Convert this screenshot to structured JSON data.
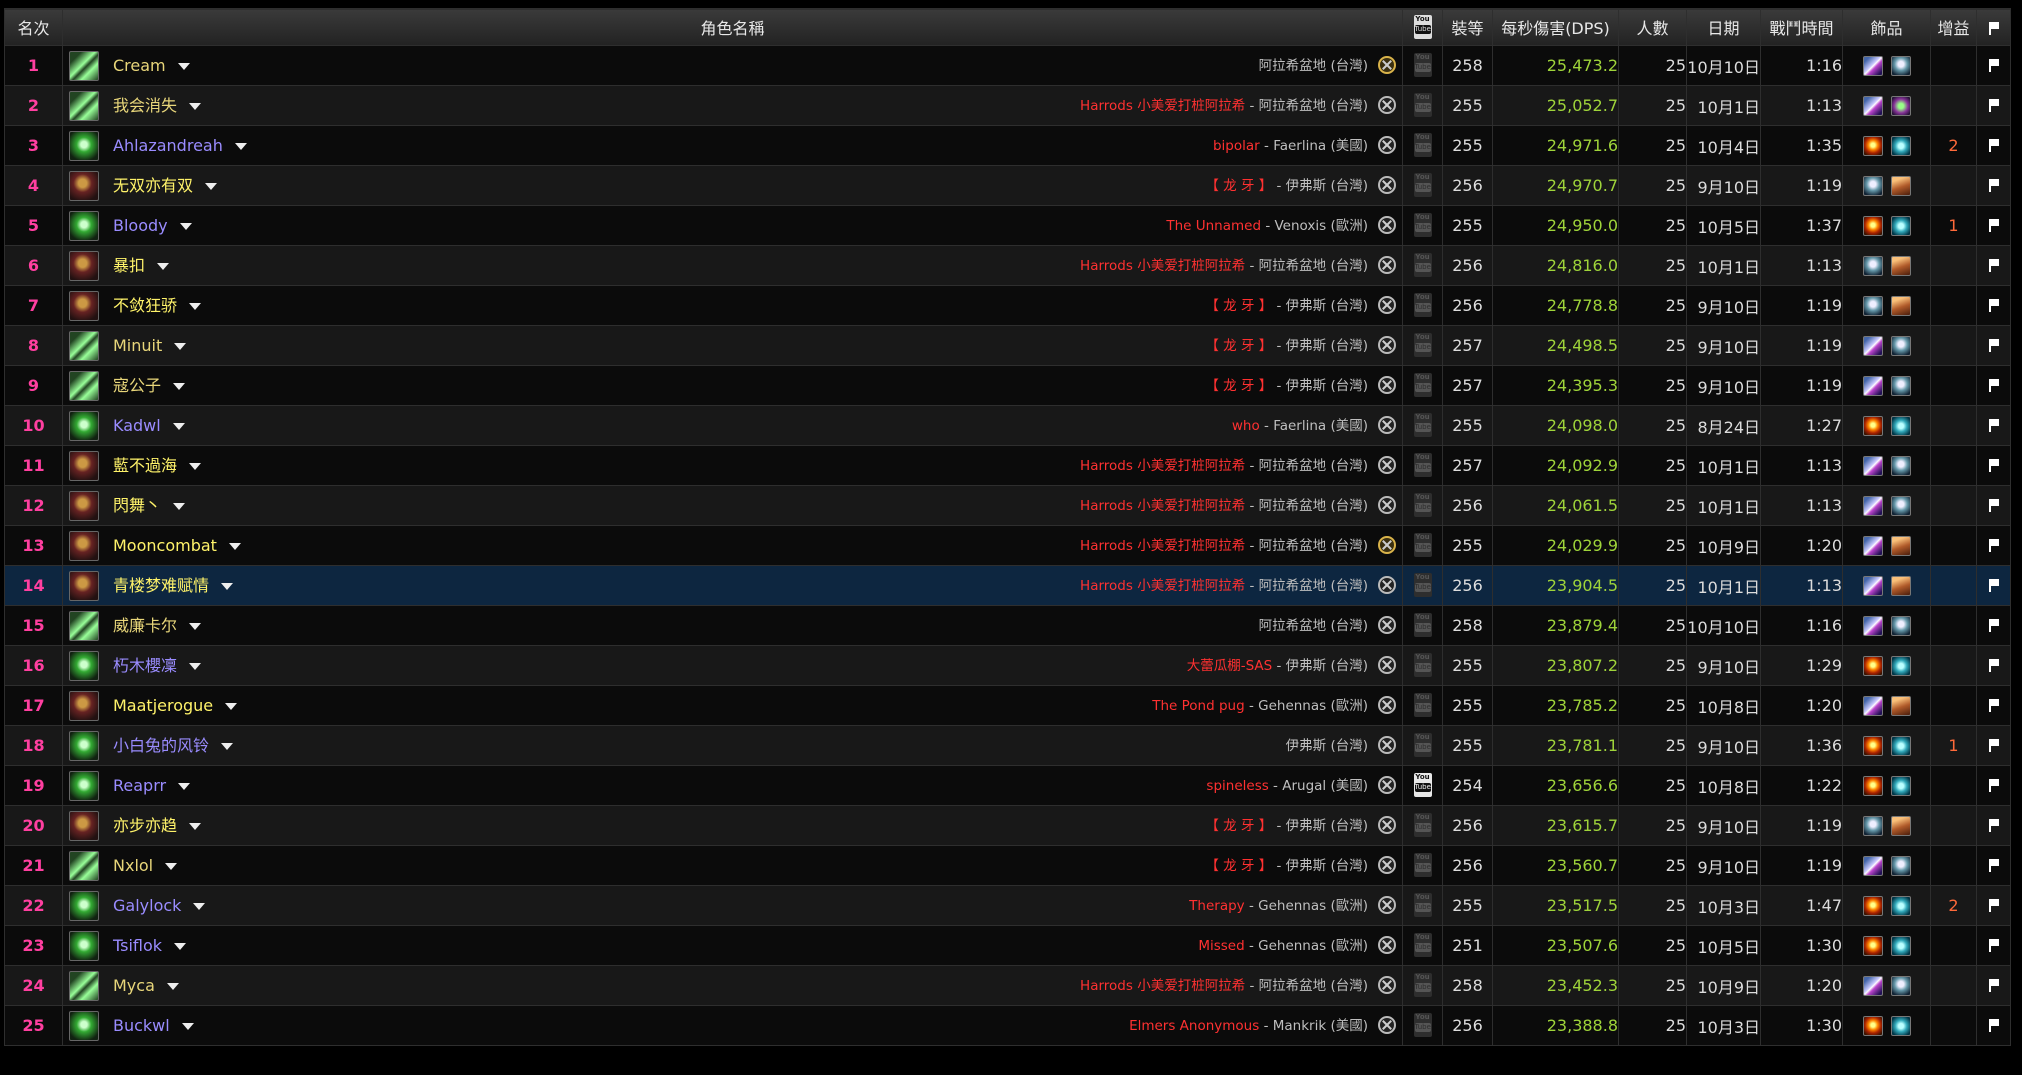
{
  "header": {
    "rank": "名次",
    "name": "角色名稱",
    "youtube_top": "You",
    "youtube_bottom": "Tube",
    "ilvl": "裝等",
    "dps": "每秒傷害(DPS)",
    "size": "人數",
    "date": "日期",
    "duration": "戰鬥時間",
    "trinkets": "飾品",
    "buffs": "增益",
    "flag_icon": "flag-icon"
  },
  "rows": [
    {
      "rank": "1",
      "name": "Cream",
      "cls": "warrior",
      "guild": "",
      "server": "阿拉希盆地 (台灣)",
      "sigil": "gold",
      "yt": false,
      "ilvl": "258",
      "dps": "25,473.2",
      "size": "25",
      "date": "10月10日",
      "time": "1:16",
      "t1": "A",
      "t2": "B",
      "buff": ""
    },
    {
      "rank": "2",
      "name": "我会消失",
      "cls": "warrior",
      "guild": "Harrods 小美爱打桩阿拉希",
      "server": "阿拉希盆地 (台灣)",
      "sigil": "silver",
      "yt": false,
      "ilvl": "255",
      "dps": "25,052.7",
      "size": "25",
      "date": "10月1日",
      "time": "1:13",
      "t1": "A",
      "t2": "F",
      "buff": ""
    },
    {
      "rank": "3",
      "name": "Ahlazandreah",
      "cls": "hunter",
      "guild": "bipolar",
      "server": "Faerlina (美國)",
      "sigil": "silver",
      "yt": false,
      "ilvl": "255",
      "dps": "24,971.6",
      "size": "25",
      "date": "10月4日",
      "time": "1:35",
      "t1": "C",
      "t2": "D",
      "buff": "2"
    },
    {
      "rank": "4",
      "name": "无双亦有双",
      "cls": "rogue",
      "guild": "【 龙 牙 】",
      "server": "伊弗斯 (台灣)",
      "sigil": "silver",
      "yt": false,
      "ilvl": "256",
      "dps": "24,970.7",
      "size": "25",
      "date": "9月10日",
      "time": "1:19",
      "t1": "B",
      "t2": "E",
      "buff": ""
    },
    {
      "rank": "5",
      "name": "Bloody",
      "cls": "hunter",
      "guild": "The Unnamed",
      "server": "Venoxis (歐洲)",
      "sigil": "silver",
      "yt": false,
      "ilvl": "255",
      "dps": "24,950.0",
      "size": "25",
      "date": "10月5日",
      "time": "1:37",
      "t1": "C",
      "t2": "D",
      "buff": "1"
    },
    {
      "rank": "6",
      "name": "暴扣",
      "cls": "rogue",
      "guild": "Harrods 小美爱打桩阿拉希",
      "server": "阿拉希盆地 (台灣)",
      "sigil": "silver",
      "yt": false,
      "ilvl": "256",
      "dps": "24,816.0",
      "size": "25",
      "date": "10月1日",
      "time": "1:13",
      "t1": "B",
      "t2": "E",
      "buff": ""
    },
    {
      "rank": "7",
      "name": "不敛狂骄",
      "cls": "rogue",
      "guild": "【 龙 牙 】",
      "server": "伊弗斯 (台灣)",
      "sigil": "silver",
      "yt": false,
      "ilvl": "256",
      "dps": "24,778.8",
      "size": "25",
      "date": "9月10日",
      "time": "1:19",
      "t1": "B",
      "t2": "E",
      "buff": ""
    },
    {
      "rank": "8",
      "name": "Minuit",
      "cls": "warrior",
      "guild": "【 龙 牙 】",
      "server": "伊弗斯 (台灣)",
      "sigil": "silver",
      "yt": false,
      "ilvl": "257",
      "dps": "24,498.5",
      "size": "25",
      "date": "9月10日",
      "time": "1:19",
      "t1": "A",
      "t2": "B",
      "buff": ""
    },
    {
      "rank": "9",
      "name": "寇公子",
      "cls": "warrior",
      "guild": "【 龙 牙 】",
      "server": "伊弗斯 (台灣)",
      "sigil": "silver",
      "yt": false,
      "ilvl": "257",
      "dps": "24,395.3",
      "size": "25",
      "date": "9月10日",
      "time": "1:19",
      "t1": "A",
      "t2": "B",
      "buff": ""
    },
    {
      "rank": "10",
      "name": "Kadwl",
      "cls": "hunter",
      "guild": "who",
      "server": "Faerlina (美國)",
      "sigil": "silver",
      "yt": false,
      "ilvl": "255",
      "dps": "24,098.0",
      "size": "25",
      "date": "8月24日",
      "time": "1:27",
      "t1": "C",
      "t2": "D",
      "buff": ""
    },
    {
      "rank": "11",
      "name": "藍不過海",
      "cls": "rogue",
      "guild": "Harrods 小美爱打桩阿拉希",
      "server": "阿拉希盆地 (台灣)",
      "sigil": "silver",
      "yt": false,
      "ilvl": "257",
      "dps": "24,092.9",
      "size": "25",
      "date": "10月1日",
      "time": "1:13",
      "t1": "A",
      "t2": "B",
      "buff": ""
    },
    {
      "rank": "12",
      "name": "閃舞丶",
      "cls": "rogue",
      "guild": "Harrods 小美爱打桩阿拉希",
      "server": "阿拉希盆地 (台灣)",
      "sigil": "silver",
      "yt": false,
      "ilvl": "256",
      "dps": "24,061.5",
      "size": "25",
      "date": "10月1日",
      "time": "1:13",
      "t1": "A",
      "t2": "B",
      "buff": ""
    },
    {
      "rank": "13",
      "name": "Mooncombat",
      "cls": "rogue",
      "guild": "Harrods 小美爱打桩阿拉希",
      "server": "阿拉希盆地 (台灣)",
      "sigil": "gold",
      "yt": false,
      "ilvl": "255",
      "dps": "24,029.9",
      "size": "25",
      "date": "10月9日",
      "time": "1:20",
      "t1": "A",
      "t2": "E",
      "buff": ""
    },
    {
      "rank": "14",
      "name": "青楼梦难赋情",
      "cls": "rogue",
      "guild": "Harrods 小美爱打桩阿拉希",
      "server": "阿拉希盆地 (台灣)",
      "sigil": "silver",
      "yt": false,
      "ilvl": "256",
      "dps": "23,904.5",
      "size": "25",
      "date": "10月1日",
      "time": "1:13",
      "t1": "A",
      "t2": "E",
      "buff": "",
      "hl": true
    },
    {
      "rank": "15",
      "name": "威廉卡尔",
      "cls": "warrior",
      "guild": "",
      "server": "阿拉希盆地 (台灣)",
      "sigil": "silver",
      "yt": false,
      "ilvl": "258",
      "dps": "23,879.4",
      "size": "25",
      "date": "10月10日",
      "time": "1:16",
      "t1": "A",
      "t2": "B",
      "buff": ""
    },
    {
      "rank": "16",
      "name": "朽木櫻凜",
      "cls": "hunter",
      "guild": "大蕾瓜棚-SAS",
      "server": "伊弗斯 (台灣)",
      "sigil": "silver",
      "yt": false,
      "ilvl": "255",
      "dps": "23,807.2",
      "size": "25",
      "date": "9月10日",
      "time": "1:29",
      "t1": "C",
      "t2": "D",
      "buff": ""
    },
    {
      "rank": "17",
      "name": "Maatjerogue",
      "cls": "rogue",
      "guild": "The Pond pug",
      "server": "Gehennas (歐洲)",
      "sigil": "silver",
      "yt": false,
      "ilvl": "255",
      "dps": "23,785.2",
      "size": "25",
      "date": "10月8日",
      "time": "1:20",
      "t1": "A",
      "t2": "E",
      "buff": ""
    },
    {
      "rank": "18",
      "name": "小白兔的风铃",
      "cls": "hunter",
      "guild": "",
      "server": "伊弗斯 (台灣)",
      "sigil": "silver",
      "yt": false,
      "ilvl": "255",
      "dps": "23,781.1",
      "size": "25",
      "date": "9月10日",
      "time": "1:36",
      "t1": "C",
      "t2": "D",
      "buff": "1"
    },
    {
      "rank": "19",
      "name": "Reaprr",
      "cls": "hunter",
      "guild": "spineless",
      "server": "Arugal (美國)",
      "sigil": "silver",
      "yt": true,
      "ilvl": "254",
      "dps": "23,656.6",
      "size": "25",
      "date": "10月8日",
      "time": "1:22",
      "t1": "C",
      "t2": "D",
      "buff": ""
    },
    {
      "rank": "20",
      "name": "亦步亦趋",
      "cls": "rogue",
      "guild": "【 龙 牙 】",
      "server": "伊弗斯 (台灣)",
      "sigil": "silver",
      "yt": false,
      "ilvl": "256",
      "dps": "23,615.7",
      "size": "25",
      "date": "9月10日",
      "time": "1:19",
      "t1": "B",
      "t2": "E",
      "buff": ""
    },
    {
      "rank": "21",
      "name": "Nxlol",
      "cls": "warrior",
      "guild": "【 龙 牙 】",
      "server": "伊弗斯 (台灣)",
      "sigil": "silver",
      "yt": false,
      "ilvl": "256",
      "dps": "23,560.7",
      "size": "25",
      "date": "9月10日",
      "time": "1:19",
      "t1": "A",
      "t2": "B",
      "buff": ""
    },
    {
      "rank": "22",
      "name": "Galylock",
      "cls": "hunter",
      "guild": "Therapy",
      "server": "Gehennas (歐洲)",
      "sigil": "silver",
      "yt": false,
      "ilvl": "255",
      "dps": "23,517.5",
      "size": "25",
      "date": "10月3日",
      "time": "1:47",
      "t1": "C",
      "t2": "D",
      "buff": "2"
    },
    {
      "rank": "23",
      "name": "Tsiflok",
      "cls": "hunter",
      "guild": "Missed",
      "server": "Gehennas (歐洲)",
      "sigil": "silver",
      "yt": false,
      "ilvl": "251",
      "dps": "23,507.6",
      "size": "25",
      "date": "10月5日",
      "time": "1:30",
      "t1": "C",
      "t2": "D",
      "buff": ""
    },
    {
      "rank": "24",
      "name": "Myca",
      "cls": "warrior",
      "guild": "Harrods 小美爱打桩阿拉希",
      "server": "阿拉希盆地 (台灣)",
      "sigil": "silver",
      "yt": false,
      "ilvl": "258",
      "dps": "23,452.3",
      "size": "25",
      "date": "10月9日",
      "time": "1:20",
      "t1": "A",
      "t2": "B",
      "buff": ""
    },
    {
      "rank": "25",
      "name": "Buckwl",
      "cls": "hunter",
      "guild": "Elmers Anonymous",
      "server": "Mankrik (美國)",
      "sigil": "silver",
      "yt": false,
      "ilvl": "256",
      "dps": "23,388.8",
      "size": "25",
      "date": "10月3日",
      "time": "1:30",
      "t1": "C",
      "t2": "D",
      "buff": ""
    }
  ]
}
